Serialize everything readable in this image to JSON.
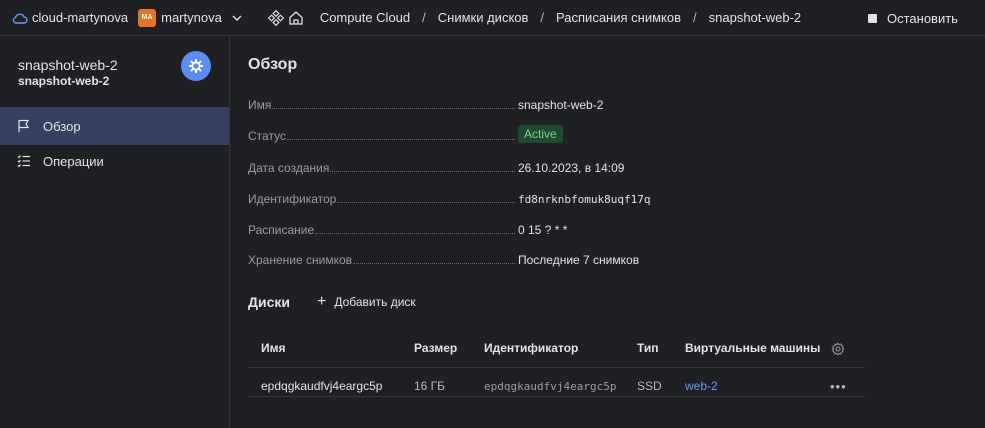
{
  "topbar": {
    "cloud_name": "cloud-martynova",
    "avatar_initials": "MA",
    "folder_name": "martynova",
    "breadcrumbs": [
      "Compute Cloud",
      "Снимки дисков",
      "Расписания снимков",
      "snapshot-web-2"
    ],
    "stop_label": "Остановить"
  },
  "sidebar": {
    "title": "snapshot-web-2",
    "subtitle": "snapshot-web-2",
    "items": [
      {
        "label": "Обзор",
        "icon": "flag-icon",
        "active": true
      },
      {
        "label": "Операции",
        "icon": "list-icon",
        "active": false
      }
    ]
  },
  "overview": {
    "title": "Обзор",
    "fields": [
      {
        "label": "Имя",
        "value": "snapshot-web-2"
      },
      {
        "label": "Статус",
        "value": "Active"
      },
      {
        "label": "Дата создания",
        "value": "26.10.2023, в 14:09"
      },
      {
        "label": "Идентификатор",
        "value": "fd8nrknbfomuk8uqf17q"
      },
      {
        "label": "Расписание",
        "value": "0 15 ? * *"
      },
      {
        "label": "Хранение снимков",
        "value": "Последние 7 снимков"
      }
    ]
  },
  "disks": {
    "title": "Диски",
    "add_label": "Добавить диск",
    "columns": [
      "Имя",
      "Размер",
      "Идентификатор",
      "Тип",
      "Виртуальные машины"
    ],
    "rows": [
      {
        "name": "epdqgkaudfvj4eargc5p",
        "size": "16 ГБ",
        "id": "epdqgkaudfvj4eargc5p",
        "type": "SSD",
        "vm": "web-2"
      }
    ]
  },
  "colors": {
    "accent": "#5b8def",
    "status_active_bg": "#1f4a30",
    "status_active_text": "#7fcf8f",
    "link": "#6b98f5",
    "avatar": "#e7732a"
  }
}
